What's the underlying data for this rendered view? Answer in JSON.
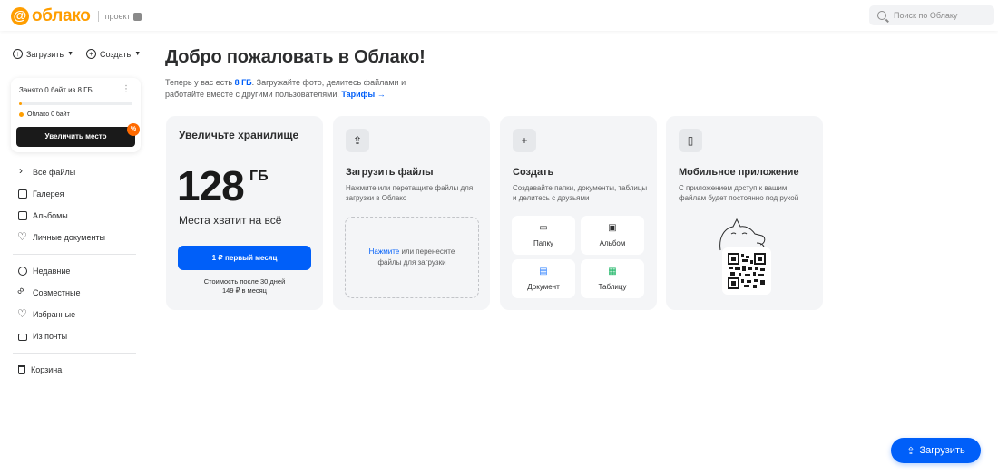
{
  "header": {
    "logo_symbol": "@",
    "logo_text": "облако",
    "project_label": "проект",
    "search_placeholder": "Поиск по Облаку"
  },
  "sidebar": {
    "upload_label": "Загрузить",
    "create_label": "Создать",
    "storage": {
      "used_text": "Занято 0 байт из 8 ГБ",
      "used_fraction": 0.0,
      "legend_text": "Облако 0 байт",
      "upgrade_label": "Увеличить место",
      "badge_text": "%"
    },
    "nav_main": [
      {
        "label": "Все файлы",
        "icon": "chevron-right-icon"
      },
      {
        "label": "Галерея",
        "icon": "gallery-icon"
      },
      {
        "label": "Альбомы",
        "icon": "albums-icon"
      },
      {
        "label": "Личные документы",
        "icon": "documents-icon"
      }
    ],
    "nav_secondary": [
      {
        "label": "Недавние",
        "icon": "recent-icon"
      },
      {
        "label": "Совместные",
        "icon": "shared-icon"
      },
      {
        "label": "Избранные",
        "icon": "favorites-icon"
      },
      {
        "label": "Из почты",
        "icon": "mail-icon"
      }
    ],
    "nav_trash": {
      "label": "Корзина",
      "icon": "trash-icon"
    }
  },
  "main": {
    "title": "Добро пожаловать в Облако!",
    "subtitle_pre": "Теперь у вас есть ",
    "subtitle_accent": "8 ГБ",
    "subtitle_post": ". Загружайте фото, делитесь файлами и работайте вместе с другими пользователями. ",
    "tariffs_link": "Тарифы →",
    "cards": {
      "storage": {
        "title": "Увеличьте хранилище",
        "size": "128",
        "unit": "ГБ",
        "enough": "Места хватит на всё",
        "button": "1 ₽ первый месяц",
        "price_line1": "Стоимость после 30 дней",
        "price_line2": "149 ₽ в месяц"
      },
      "upload": {
        "title": "Загрузить файлы",
        "desc": "Нажмите или перетащите файлы для загрузки в Облако",
        "drop_link": "Нажмите",
        "drop_text1": " или перенесите",
        "drop_text2": "файлы для загрузки"
      },
      "create": {
        "title": "Создать",
        "desc": "Создавайте папки, документы, таблицы и делитесь с друзьями",
        "items": [
          "Папку",
          "Альбом",
          "Документ",
          "Таблицу"
        ]
      },
      "mobile": {
        "title": "Мобильное приложение",
        "desc": "С приложением доступ к вашим файлам будет постоянно под рукой"
      }
    }
  },
  "fab": {
    "label": "Загрузить"
  },
  "colors": {
    "accent": "#005ff9",
    "brand": "#ff9e00",
    "button_dark": "#1a1a1a"
  }
}
